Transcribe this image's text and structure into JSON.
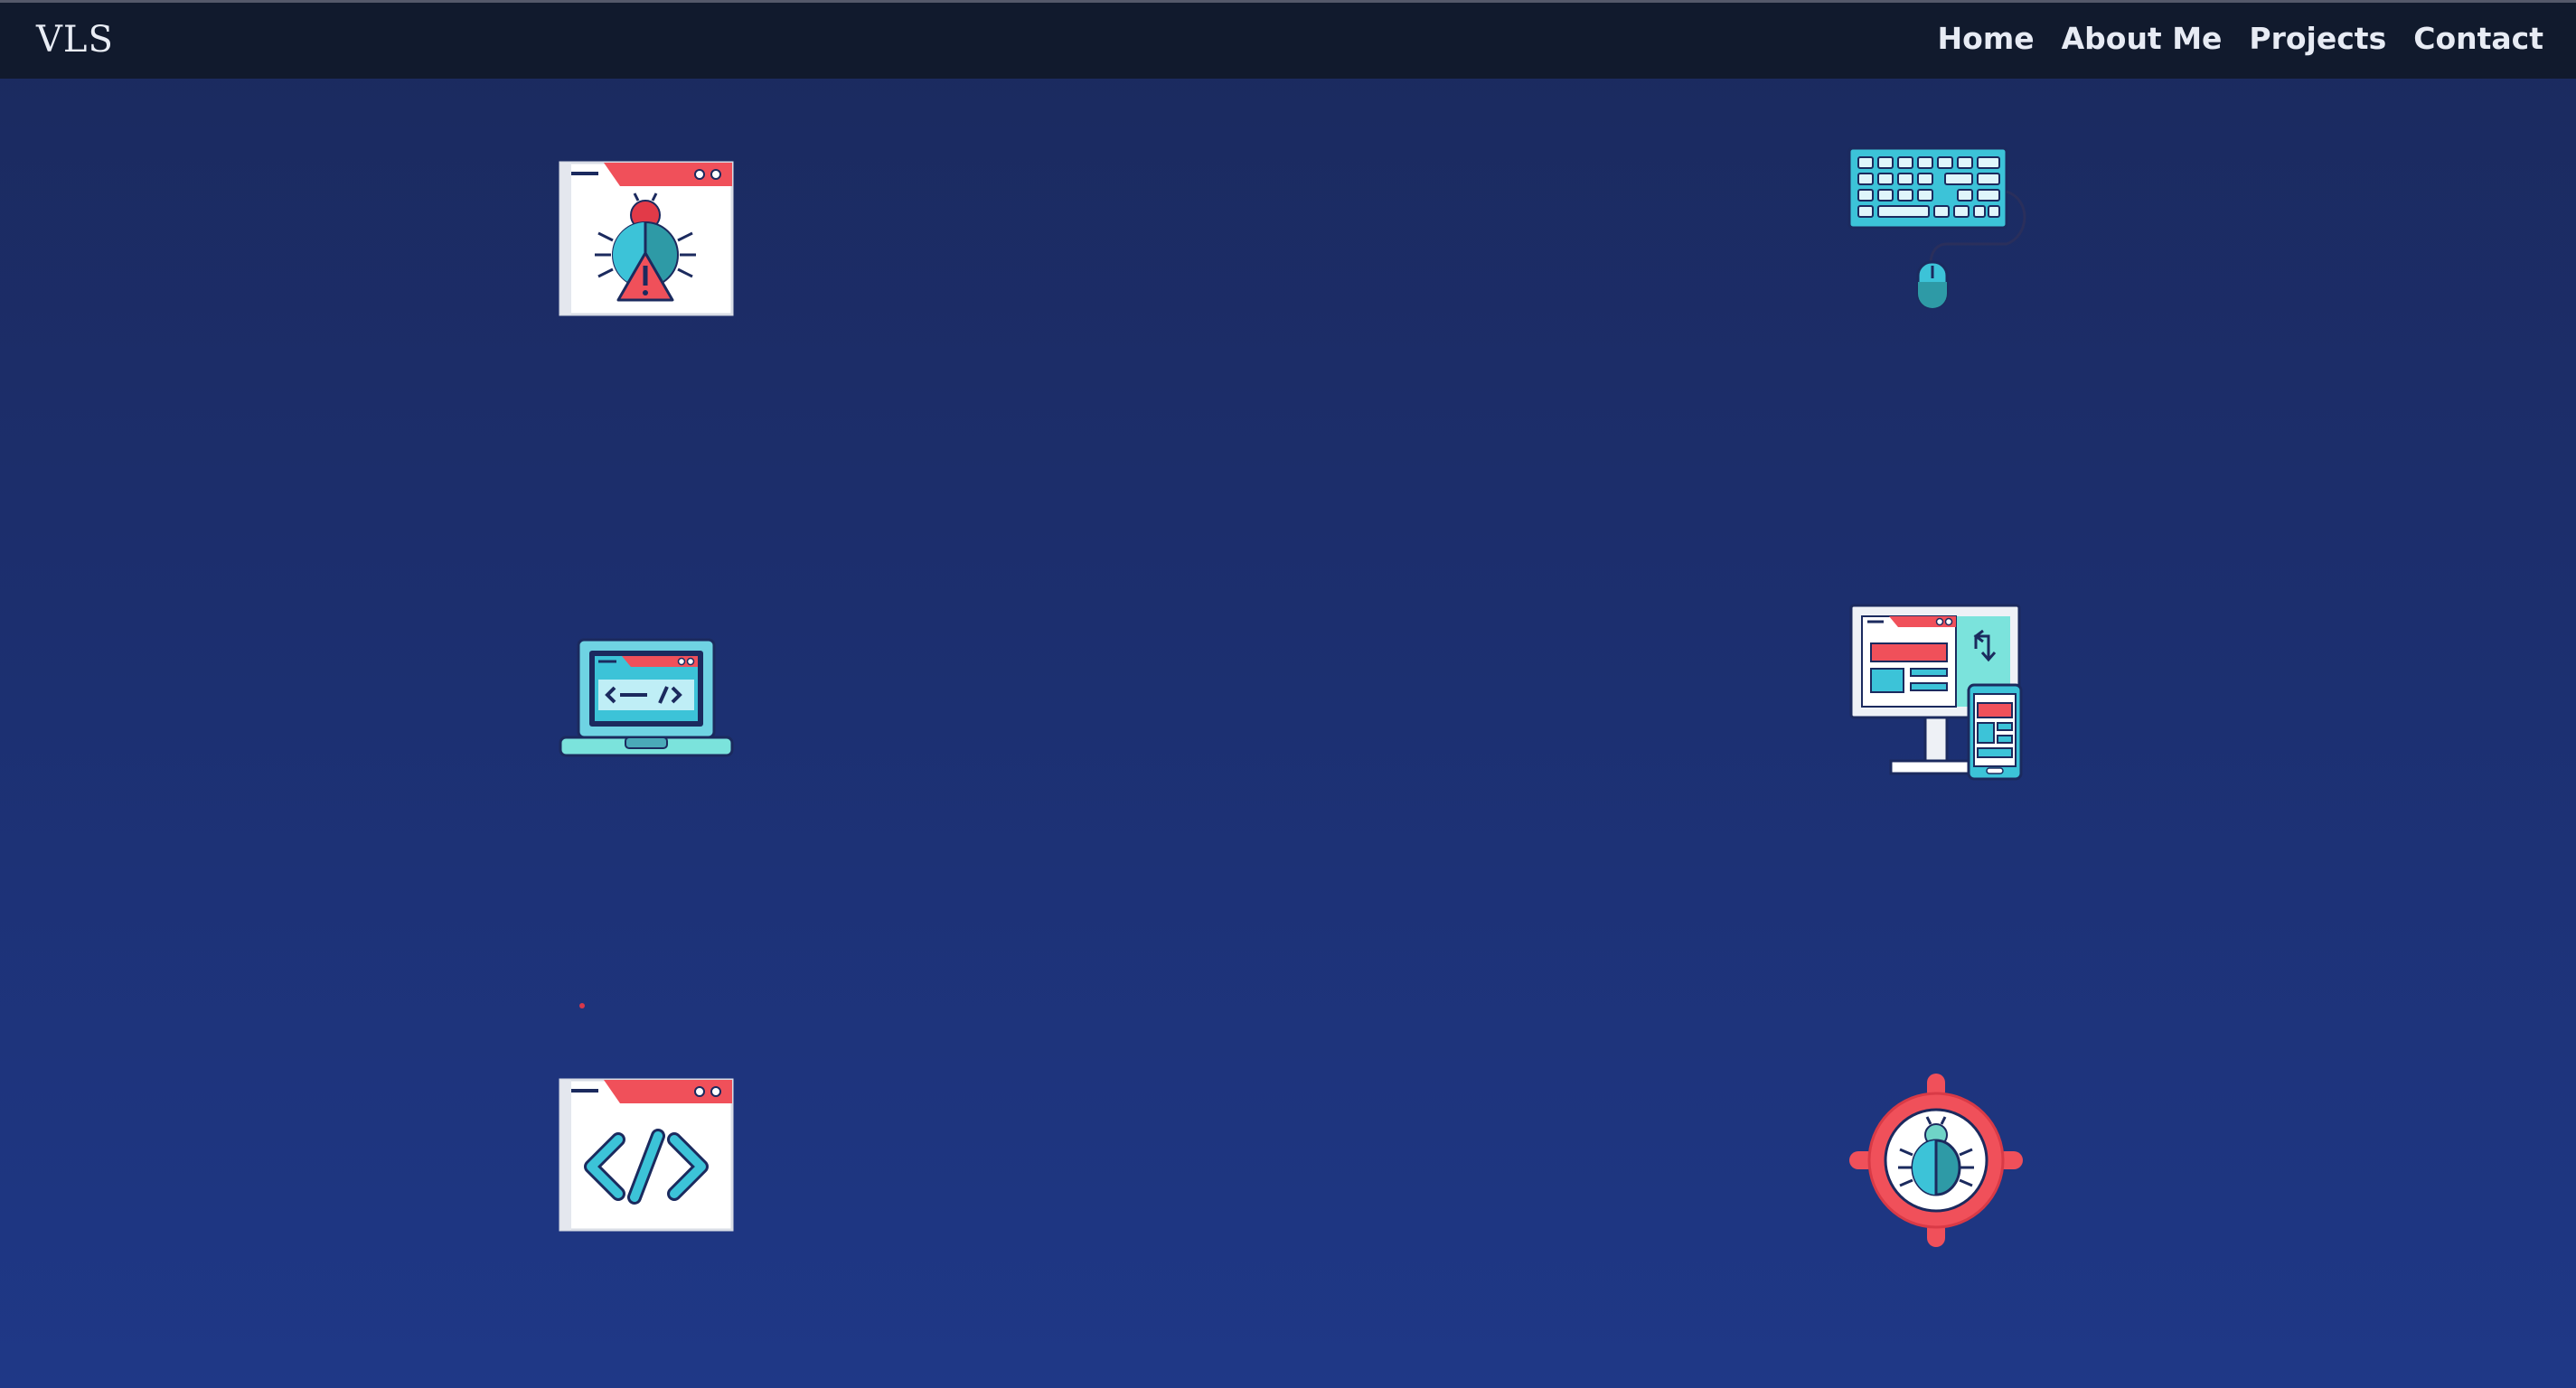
{
  "brand": {
    "name": "VLS"
  },
  "nav": {
    "items": [
      {
        "label": "Home"
      },
      {
        "label": "About Me"
      },
      {
        "label": "Projects"
      },
      {
        "label": "Contact"
      }
    ]
  },
  "icons": [
    {
      "name": "browser-bug-warning-icon"
    },
    {
      "name": "keyboard-mouse-icon"
    },
    {
      "name": "laptop-code-icon"
    },
    {
      "name": "responsive-devices-icon"
    },
    {
      "name": "browser-code-icon"
    },
    {
      "name": "bug-target-icon"
    }
  ],
  "colors": {
    "background_top": "#1b2a5e",
    "background_bottom": "#1f3887",
    "navbar": "#111a2d",
    "nav_text": "#e7ebf4",
    "accent_red": "#f0505a",
    "accent_cyan": "#3cc3d8",
    "accent_teal": "#2e9aa6"
  }
}
